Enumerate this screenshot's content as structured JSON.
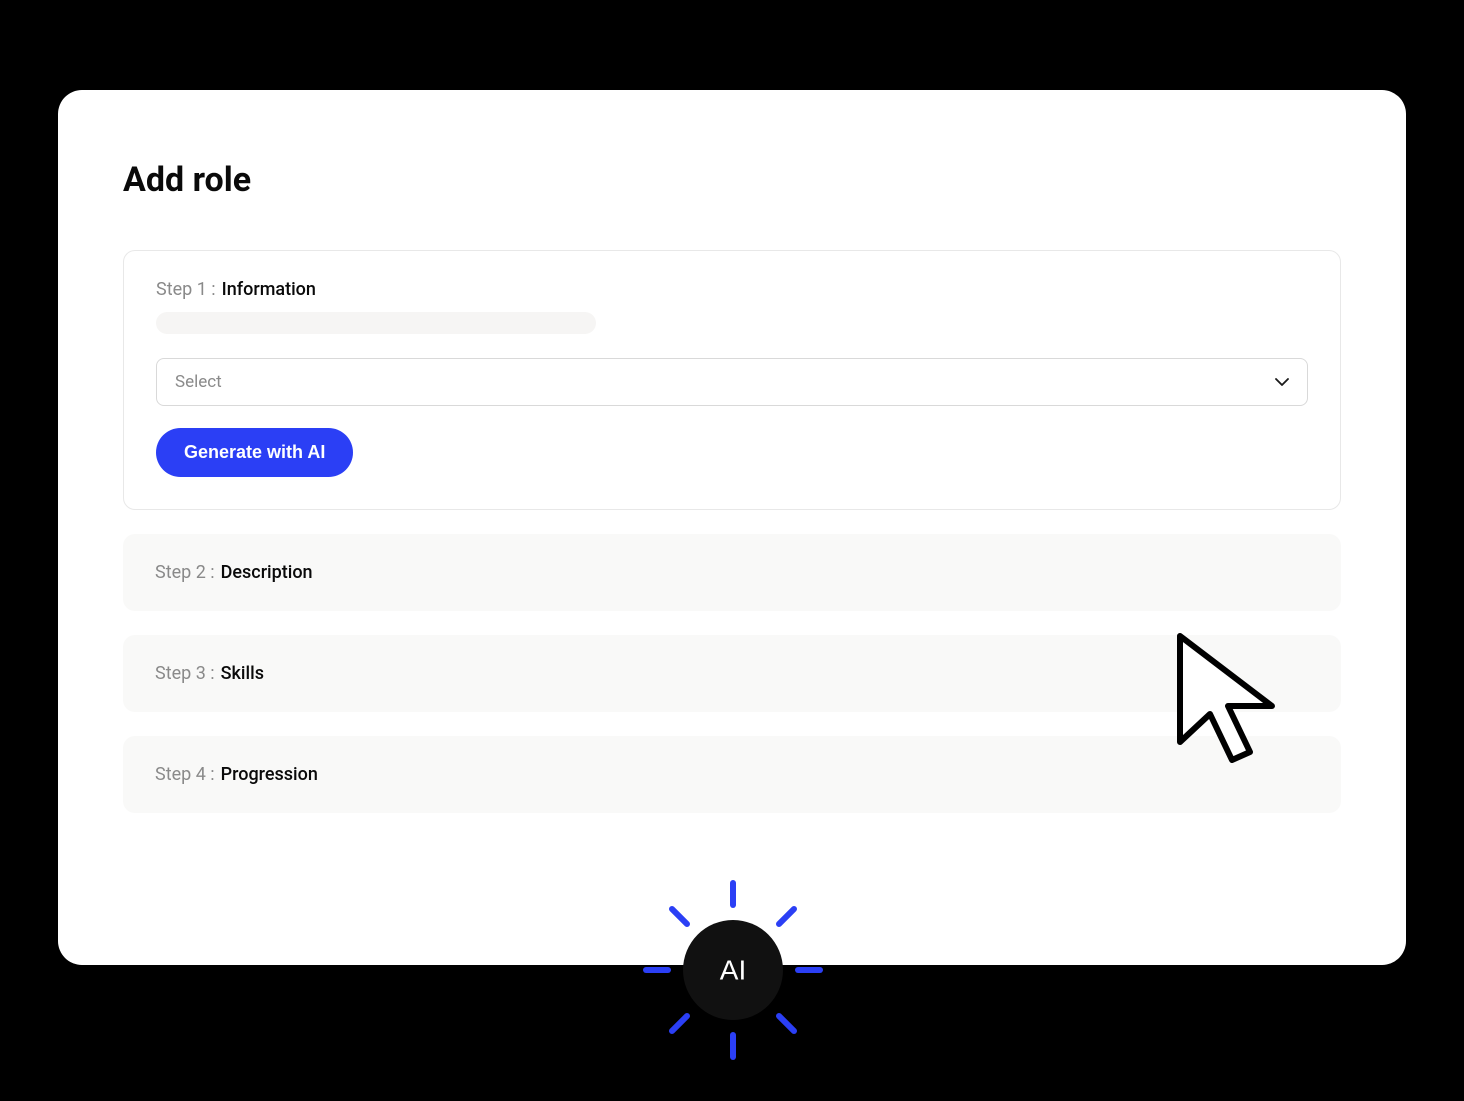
{
  "page": {
    "title": "Add role"
  },
  "steps": [
    {
      "label": "Step 1 :",
      "name": "Information"
    },
    {
      "label": "Step 2 :",
      "name": "Description"
    },
    {
      "label": "Step 3 :",
      "name": "Skills"
    },
    {
      "label": "Step 4 :",
      "name": "Progression"
    }
  ],
  "select": {
    "placeholder": "Select"
  },
  "buttons": {
    "generate": "Generate with AI"
  },
  "ai_badge": {
    "label": "AI"
  },
  "colors": {
    "accent": "#2b3ff5",
    "dark": "#0f0f0f"
  }
}
